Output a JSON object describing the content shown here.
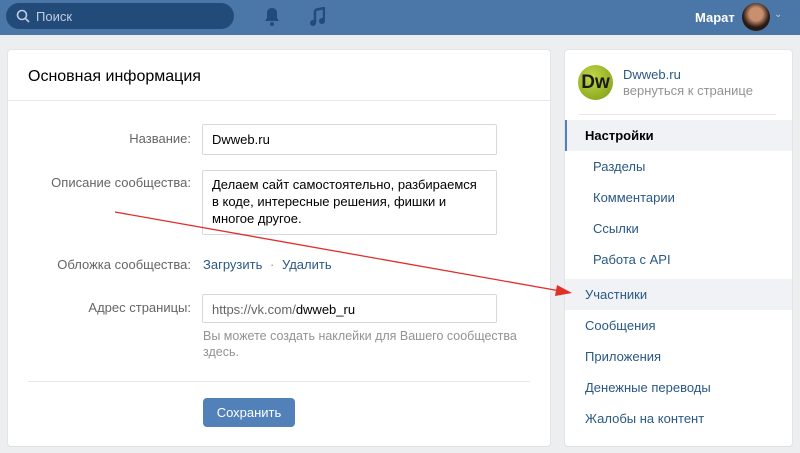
{
  "header": {
    "search_placeholder": "Поиск",
    "user_name": "Марат"
  },
  "main": {
    "title": "Основная информация",
    "name_label": "Название:",
    "name_value": "Dwweb.ru",
    "desc_label": "Описание сообщества:",
    "desc_value": "Делаем сайт самостоятельно, разбираемся в коде, интересные  решения, фишки и многое другое.",
    "cover_label": "Обложка сообщества:",
    "upload": "Загрузить",
    "sep": "·",
    "delete": "Удалить",
    "address_label": "Адрес страницы:",
    "address_prefix": "https://vk.com/",
    "address_value": "dwweb_ru",
    "hint": "Вы можете создать наклейки для Вашего сообщества здесь.",
    "save": "Сохранить"
  },
  "side": {
    "logo": "Dw",
    "group_name": "Dwweb.ru",
    "back": "вернуться к странице",
    "items": [
      "Настройки",
      "Разделы",
      "Комментарии",
      "Ссылки",
      "Работа с API",
      "Участники",
      "Сообщения",
      "Приложения",
      "Денежные переводы",
      "Жалобы на контент"
    ]
  },
  "colors": {
    "header": "#4a76a8",
    "accent": "#5181b8",
    "arrow": "#e0302a"
  }
}
